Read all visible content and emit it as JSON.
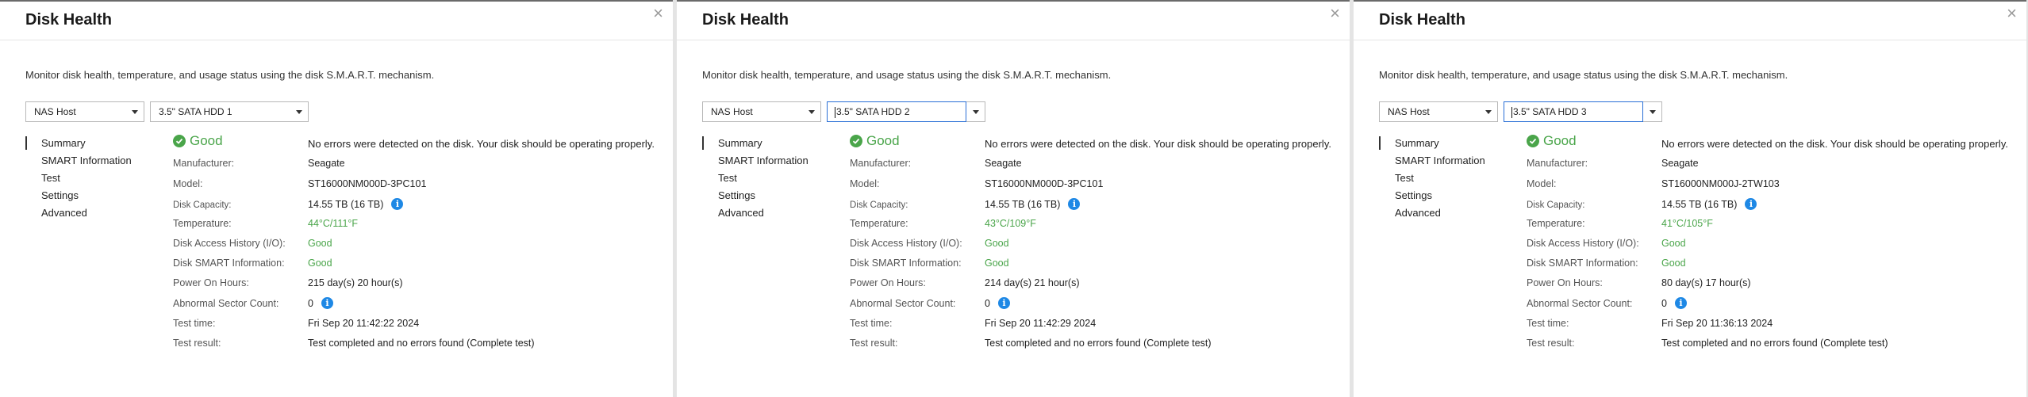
{
  "panels": [
    {
      "title": "Disk Health",
      "close": "×",
      "description": "Monitor disk health, temperature, and usage status using the disk S.M.A.R.T. mechanism.",
      "host_select": "NAS Host",
      "disk_select": "3.5\" SATA HDD 1",
      "nav": [
        "Summary",
        "SMART Information",
        "Test",
        "Settings",
        "Advanced"
      ],
      "status": "Good",
      "status_message": "No errors were detected on the disk. Your disk should be operating properly.",
      "labels": {
        "manufacturer": "Manufacturer:",
        "model": "Model:",
        "capacity": "Disk Capacity:",
        "temperature": "Temperature:",
        "access_history": "Disk Access History (I/O):",
        "smart_info": "Disk SMART Information:",
        "power_on": "Power On Hours:",
        "abnormal": "Abnormal Sector Count:",
        "test_time": "Test time:",
        "test_result": "Test result:"
      },
      "values": {
        "manufacturer": "Seagate",
        "model": "ST16000NM000D-3PC101",
        "capacity": "14.55 TB (16 TB)",
        "temperature": "44°C/111°F",
        "access_history": "Good",
        "smart_info": "Good",
        "power_on": "215 day(s) 20 hour(s)",
        "abnormal": "0",
        "test_time": "Fri Sep 20 11:42:22 2024",
        "test_result": "Test completed and no errors found (Complete test)"
      }
    },
    {
      "title": "Disk Health",
      "close": "×",
      "description": "Monitor disk health, temperature, and usage status using the disk S.M.A.R.T. mechanism.",
      "host_select": "NAS Host",
      "disk_select": "3.5\" SATA HDD 2",
      "nav": [
        "Summary",
        "SMART Information",
        "Test",
        "Settings",
        "Advanced"
      ],
      "status": "Good",
      "status_message": "No errors were detected on the disk. Your disk should be operating properly.",
      "labels": {
        "manufacturer": "Manufacturer:",
        "model": "Model:",
        "capacity": "Disk Capacity:",
        "temperature": "Temperature:",
        "access_history": "Disk Access History (I/O):",
        "smart_info": "Disk SMART Information:",
        "power_on": "Power On Hours:",
        "abnormal": "Abnormal Sector Count:",
        "test_time": "Test time:",
        "test_result": "Test result:"
      },
      "values": {
        "manufacturer": "Seagate",
        "model": "ST16000NM000D-3PC101",
        "capacity": "14.55 TB (16 TB)",
        "temperature": "43°C/109°F",
        "access_history": "Good",
        "smart_info": "Good",
        "power_on": "214 day(s) 21 hour(s)",
        "abnormal": "0",
        "test_time": "Fri Sep 20 11:42:29 2024",
        "test_result": "Test completed and no errors found (Complete test)"
      }
    },
    {
      "title": "Disk Health",
      "close": "×",
      "description": "Monitor disk health, temperature, and usage status using the disk S.M.A.R.T. mechanism.",
      "host_select": "NAS Host",
      "disk_select": "3.5\" SATA HDD 3",
      "nav": [
        "Summary",
        "SMART Information",
        "Test",
        "Settings",
        "Advanced"
      ],
      "status": "Good",
      "status_message": "No errors were detected on the disk. Your disk should be operating properly.",
      "labels": {
        "manufacturer": "Manufacturer:",
        "model": "Model:",
        "capacity": "Disk Capacity:",
        "temperature": "Temperature:",
        "access_history": "Disk Access History (I/O):",
        "smart_info": "Disk SMART Information:",
        "power_on": "Power On Hours:",
        "abnormal": "Abnormal Sector Count:",
        "test_time": "Test time:",
        "test_result": "Test result:"
      },
      "values": {
        "manufacturer": "Seagate",
        "model": "ST16000NM000J-2TW103",
        "capacity": "14.55 TB (16 TB)",
        "temperature": "41°C/105°F",
        "access_history": "Good",
        "smart_info": "Good",
        "power_on": "80 day(s) 17 hour(s)",
        "abnormal": "0",
        "test_time": "Fri Sep 20 11:36:13 2024",
        "test_result": "Test completed and no errors found (Complete test)"
      }
    }
  ],
  "icons": {
    "info": "i",
    "check": "✓"
  },
  "colors": {
    "good": "#4aa54a",
    "info": "#1e88e5",
    "focus": "#2a6fd6"
  }
}
